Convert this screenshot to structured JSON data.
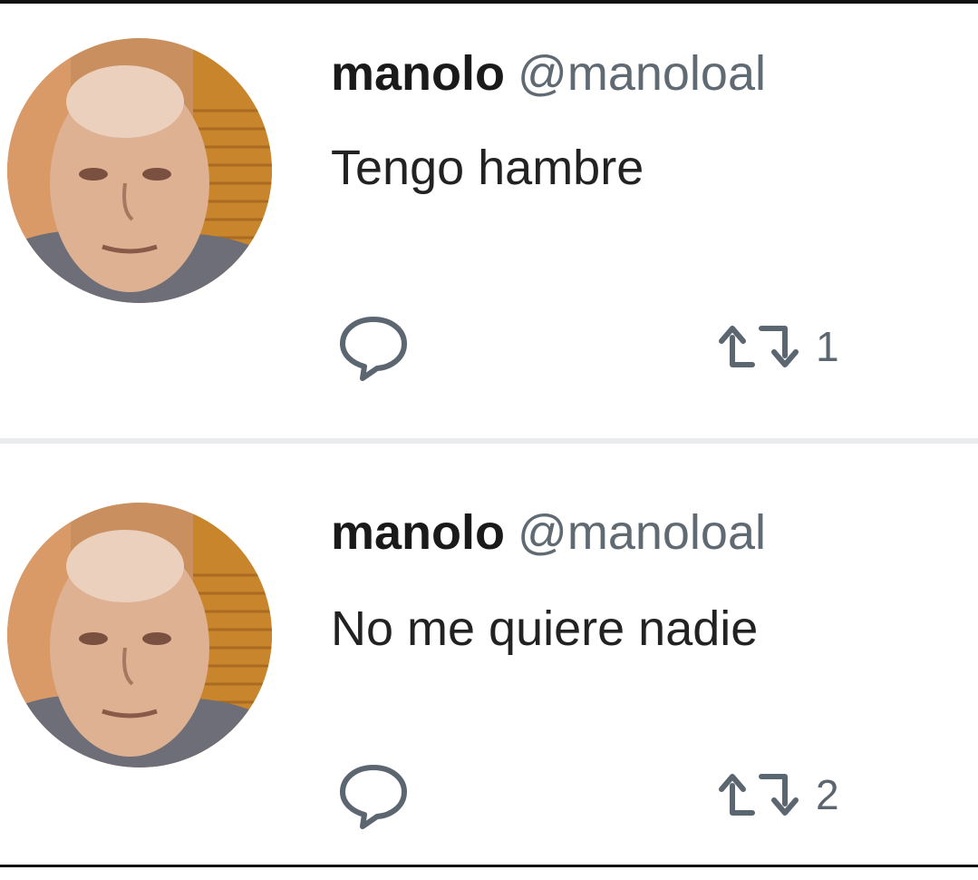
{
  "tweets": [
    {
      "name": "manolo",
      "handle": "@manoloal",
      "text": "Tengo hambre",
      "actions": {
        "reply_icon": "reply-bubble-icon",
        "retweet_icon": "retweet-icon",
        "retweet_count": "1"
      }
    },
    {
      "name": "manolo",
      "handle": "@manoloal",
      "text": "No me quiere nadie",
      "actions": {
        "reply_icon": "reply-bubble-icon",
        "retweet_icon": "retweet-icon",
        "retweet_count": "2"
      }
    }
  ],
  "colors": {
    "name": "#1a1a1a",
    "handle": "#606a73",
    "action": "#5b6670",
    "separator": "#e9ebee"
  }
}
